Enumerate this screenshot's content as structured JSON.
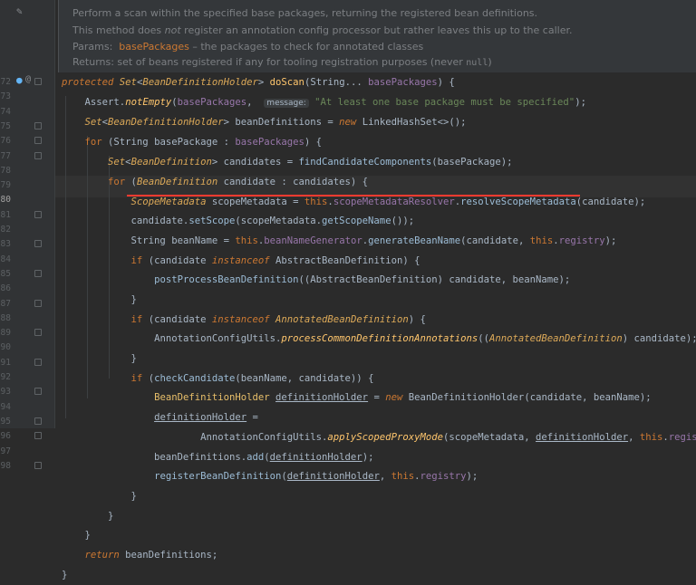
{
  "doc": {
    "line1": "Perform a scan within the specified base packages, returning the registered bean definitions.",
    "line2a": "This method does ",
    "line2b": "not",
    "line2c": " register an annotation config processor but rather leaves this up to the caller.",
    "params_label": "Params:",
    "params_name": "basePackages",
    "params_desc": " – the packages to check for annotated classes",
    "returns_text": "Returns: set of beans registered if any for tooling registration purposes (never ",
    "returns_code": "null",
    "returns_end": ")"
  },
  "gutter": {
    "line_numbers": [
      "72",
      "73",
      "74",
      "75",
      "76",
      "77",
      "78",
      "79",
      "80",
      "81",
      "82",
      "83",
      "84",
      "85",
      "86",
      "87",
      "88",
      "89",
      "90",
      "91",
      "92",
      "93",
      "94",
      "95",
      "96",
      "97",
      "98"
    ],
    "current_line": "80"
  },
  "code": {
    "hint_message": "message:",
    "assert_string": "\"At least one base package must be specified\""
  }
}
